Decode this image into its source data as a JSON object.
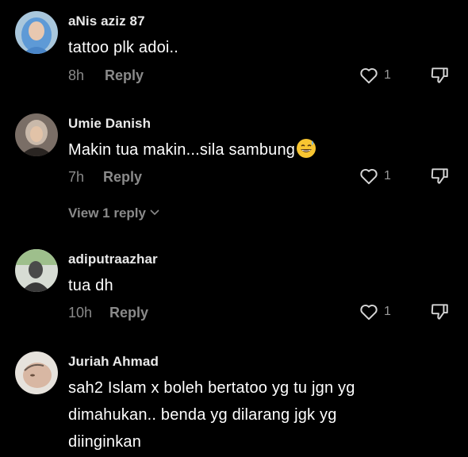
{
  "comments": [
    {
      "username": "aNis aziz 87",
      "text": "tattoo plk adoi..",
      "time": "8h",
      "reply_label": "Reply",
      "likes": "1"
    },
    {
      "username": "Umie Danish",
      "text": "Makin tua makin...sila sambung",
      "emoji": "grinning-face-with-sweat-emoji",
      "time": "7h",
      "reply_label": "Reply",
      "likes": "1",
      "view_replies": "View 1 reply"
    },
    {
      "username": "adiputraazhar",
      "text": "tua dh",
      "time": "10h",
      "reply_label": "Reply",
      "likes": "1"
    },
    {
      "username": "Juriah Ahmad",
      "text_lines": [
        "sah2 Islam x boleh bertatoo yg tu jgn yg",
        "dimahukan.. benda yg dilarang jgk yg",
        "diinginkan"
      ]
    }
  ],
  "colors": {
    "background": "#000000",
    "text": "#ffffff",
    "muted": "#8a8a8a"
  },
  "icons": {
    "like": "heart-outline-icon",
    "dislike": "thumbs-down-outline-icon",
    "expand": "chevron-down-icon"
  }
}
